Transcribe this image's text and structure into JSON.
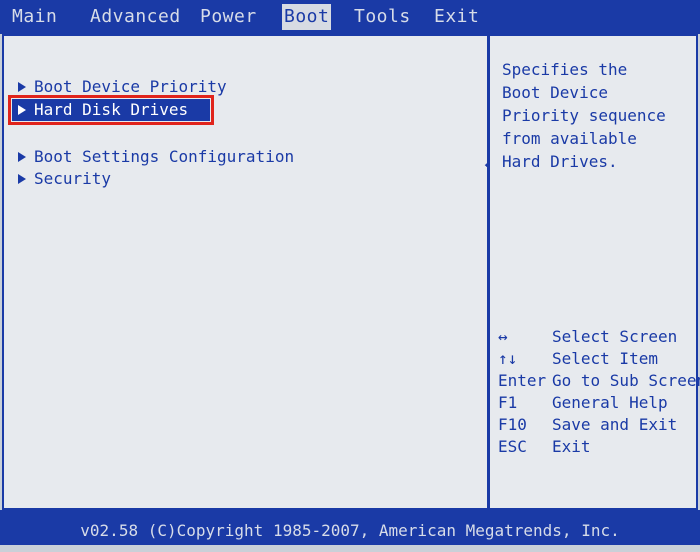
{
  "menu_bar": {
    "tabs": [
      "Main",
      "Advanced",
      "Power",
      "Boot",
      "Tools",
      "Exit"
    ],
    "active": "Boot"
  },
  "boot_menu": {
    "items": [
      "Boot Device Priority",
      "Hard Disk Drives",
      "Boot Settings Configuration",
      "Security"
    ],
    "selected": "Hard Disk Drives"
  },
  "help": {
    "lines": [
      "Specifies the",
      "Boot Device",
      "Priority sequence",
      "from available",
      "Hard Drives."
    ]
  },
  "key_legend": [
    {
      "key": "↔",
      "action": "Select Screen"
    },
    {
      "key": "↑↓",
      "action": "Select Item"
    },
    {
      "key": "Enter",
      "action": "Go to Sub Screen"
    },
    {
      "key": "F1",
      "action": "General Help"
    },
    {
      "key": "F10",
      "action": "Save and Exit"
    },
    {
      "key": "ESC",
      "action": "Exit"
    }
  ],
  "cursor_icon": "move-cursor-icon",
  "footer": {
    "copyright": "v02.58 (C)Copyright 1985-2007, American Megatrends, Inc."
  },
  "colors": {
    "bios_blue": "#1a3aa6",
    "panel_bg": "#e7eaee",
    "highlight_border": "#e0241b"
  }
}
